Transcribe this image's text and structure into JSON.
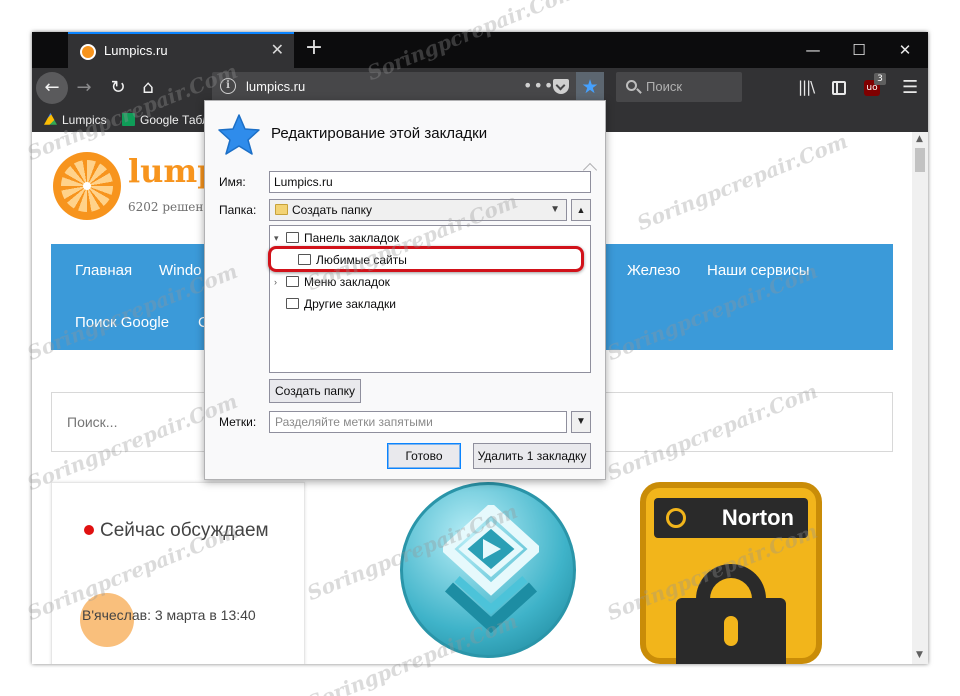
{
  "tab": {
    "title": "Lumpics.ru",
    "close": "✕"
  },
  "tabstrip": {
    "new_tab": "+",
    "minimize": "—",
    "maximize": "☐",
    "close": "✕"
  },
  "navbar": {
    "back": "←",
    "forward": "→",
    "reload": "↻",
    "home": "⌂",
    "url": "lumpics.ru",
    "url_actions": "•••",
    "search_placeholder": "Поиск",
    "library": "|||\\",
    "ublock_badge": "3",
    "ublock_label": "uo",
    "menu": "☰"
  },
  "bookmarks_bar": {
    "items": [
      {
        "label": "Lumpics"
      },
      {
        "label": "Google Табл"
      }
    ]
  },
  "page": {
    "site_title": "lumpic",
    "site_subtitle": "6202 решен",
    "nav_links": [
      "Главная",
      "Windo",
      "Железо",
      "Наши сервисы",
      "Поиск Google",
      "C"
    ],
    "search_placeholder": "Поиск...",
    "discuss_title": "Сейчас обсуждаем",
    "discuss_comment": "В'ячеслав: 3 марта в 13:40",
    "norton_label": "Norton"
  },
  "dialog": {
    "title": "Редактирование этой закладки",
    "name_label": "Имя:",
    "name_value": "Lumpics.ru",
    "folder_label": "Папка:",
    "folder_value": "Создать папку",
    "tree": [
      {
        "label": "Панель закладок",
        "twisty": "▾"
      },
      {
        "label": "Любимые сайты",
        "twisty": ""
      },
      {
        "label": "Меню закладок",
        "twisty": "›"
      },
      {
        "label": "Другие закладки",
        "twisty": ""
      }
    ],
    "create_folder": "Создать папку",
    "tags_label": "Метки:",
    "tags_placeholder": "Разделяйте метки запятыми",
    "done": "Готово",
    "remove": "Удалить 1 закладку"
  },
  "watermark": "Soringpcrepair.Com",
  "colors": {
    "accent": "#0a84ff",
    "nav_blue": "#3b9ad9",
    "brand_orange": "#f7941d",
    "highlight_red": "#d1121a"
  }
}
